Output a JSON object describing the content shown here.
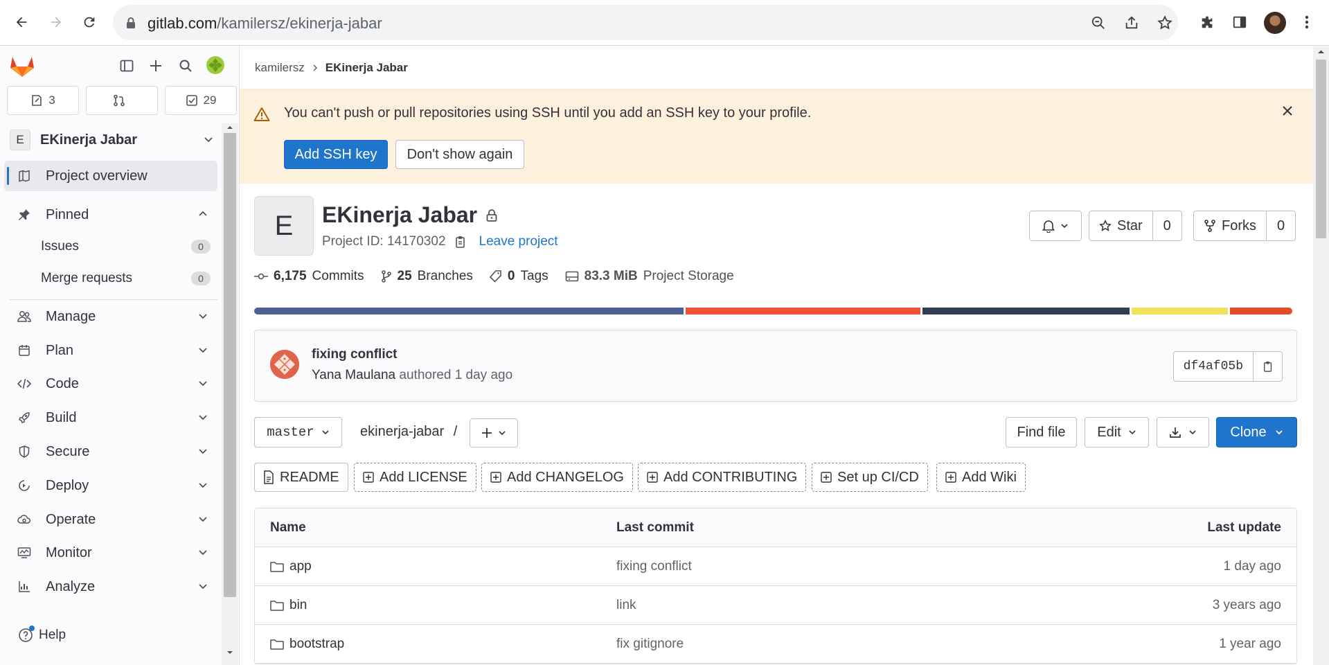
{
  "browser": {
    "url_host": "gitlab.com",
    "url_path": "/kamilersz/ekinerja-jabar"
  },
  "sidebar": {
    "counts": {
      "issues": "3",
      "merge_requests": "",
      "todos": "29"
    },
    "project_badge": "E",
    "project_name": "EKinerja Jabar",
    "overview": "Project overview",
    "pinned": "Pinned",
    "pinned_items": [
      {
        "label": "Issues",
        "count": "0"
      },
      {
        "label": "Merge requests",
        "count": "0"
      }
    ],
    "sections": [
      "Manage",
      "Plan",
      "Code",
      "Build",
      "Secure",
      "Deploy",
      "Operate",
      "Monitor",
      "Analyze"
    ],
    "help": "Help"
  },
  "breadcrumb": {
    "parent": "kamilersz",
    "current": "EKinerja Jabar"
  },
  "alert": {
    "message": "You can't push or pull repositories using SSH until you add an SSH key to your profile.",
    "primary": "Add SSH key",
    "secondary": "Don't show again"
  },
  "project": {
    "avatar_letter": "E",
    "title": "EKinerja Jabar",
    "id_text": "Project ID: 14170302",
    "leave": "Leave project",
    "star_label": "Star",
    "star_count": "0",
    "forks_label": "Forks",
    "forks_count": "0"
  },
  "stats": {
    "commits_num": "6,175",
    "commits_label": "Commits",
    "branches_num": "25",
    "branches_label": "Branches",
    "tags_num": "0",
    "tags_label": "Tags",
    "storage_num": "83.3 MiB",
    "storage_label": "Project Storage"
  },
  "languages": {
    "colors": [
      "#4f5d95",
      "#f05138",
      "#2c3e50",
      "#f1e05a",
      "#e34c26"
    ],
    "shares": [
      0.415,
      0.227,
      0.2,
      0.093,
      0.06
    ]
  },
  "last_commit": {
    "title": "fixing conflict",
    "author": "Yana Maulana",
    "meta": "authored 1 day ago",
    "sha": "df4af05b"
  },
  "repo_toolbar": {
    "branch": "master",
    "path": "ekinerja-jabar",
    "slash": "/",
    "find_file": "Find file",
    "edit": "Edit",
    "clone": "Clone"
  },
  "shortcuts": [
    "README",
    "Add LICENSE",
    "Add CHANGELOG",
    "Add CONTRIBUTING",
    "Set up CI/CD",
    "Add Wiki"
  ],
  "file_table": {
    "headers": [
      "Name",
      "Last commit",
      "Last update"
    ],
    "rows": [
      {
        "name": "app",
        "commit": "fixing conflict",
        "updated": "1 day ago"
      },
      {
        "name": "bin",
        "commit": "link",
        "updated": "3 years ago"
      },
      {
        "name": "bootstrap",
        "commit": "fix gitignore",
        "updated": "1 year ago"
      }
    ]
  }
}
